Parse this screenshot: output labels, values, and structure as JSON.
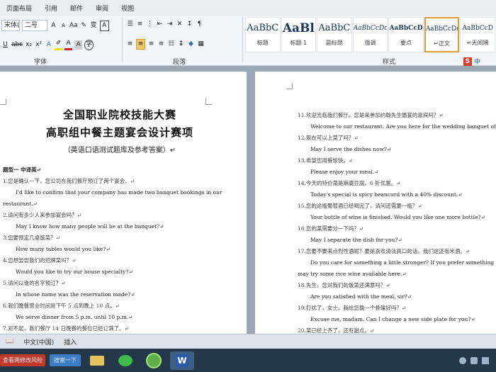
{
  "tabs": [
    "页面布局",
    "引用",
    "邮件",
    "审阅",
    "视图"
  ],
  "font": {
    "name": "宋体(正",
    "size": "二号"
  },
  "groups": {
    "font": "字体",
    "paragraph": "段落",
    "styles": "样式"
  },
  "styles": [
    {
      "preview": "AaBbC",
      "name": "标题"
    },
    {
      "preview": "AaBl",
      "name": "标题 1"
    },
    {
      "preview": "AaBbC",
      "name": "副标题"
    },
    {
      "preview": "AaBbCcDc",
      "name": "强调"
    },
    {
      "preview": "AaBbCcD",
      "name": "要点"
    },
    {
      "preview": "AaBbCcDc",
      "name": "↵正文"
    },
    {
      "preview": "AaBbCcD",
      "name": "↵无间隔"
    }
  ],
  "page1": {
    "title1": "全国职业院校技能大赛",
    "title2": "高职组中餐主题宴会设计赛项",
    "subtitle": "（英语口语测试题库及参考答案）↵",
    "section": "题型一 中译英↵",
    "lines": [
      {
        "t": "q",
        "text": "1.您是确认一下，您公司在我们餐厅预订了两个宴会。↵"
      },
      {
        "t": "a",
        "text": "I'd like to confirm that your company has made two banquet bookings in our"
      },
      {
        "t": "a",
        "text": "restaurant.↵"
      },
      {
        "t": "q",
        "text": "2.请问有多少人来参加宴会吗？↵"
      },
      {
        "t": "a",
        "text": "May I know how many people will be at the banquet?↵"
      },
      {
        "t": "q",
        "text": "3.您要预定几桌饭菜？↵"
      },
      {
        "t": "a",
        "text": "How many tables would you like?↵"
      },
      {
        "t": "q",
        "text": "4.您想尝尝我们的招牌菜吗？↵"
      },
      {
        "t": "a",
        "text": "Would you like to try our house specialty?↵"
      },
      {
        "t": "q",
        "text": "5.请问以谁的名字预订？↵"
      },
      {
        "t": "a",
        "text": "In whose name was the reservation made?↵"
      },
      {
        "t": "q",
        "text": "6.我们晚餐营业时间是下午 5 点到晚上 10 点。↵"
      },
      {
        "t": "a",
        "text": "We serve dinner from 5 p.m. until 10 p.m.↵"
      },
      {
        "t": "q",
        "text": "7.对不起，我们餐厅 14 日晚餐的餐位已经订满了。↵"
      }
    ]
  },
  "page2": {
    "lines": [
      {
        "t": "q",
        "text": "11.欢迎光临我们餐厅。您是来参加约翰先生婚宴的嘉宾吗？↵"
      },
      {
        "t": "a",
        "text": "Welcome to our restaurant. Are you here for the wedding banquet of Mr John?↵"
      },
      {
        "t": "q",
        "text": "12.现在可以上菜了吗？↵"
      },
      {
        "t": "a",
        "text": "May I serve the dishes now?↵"
      },
      {
        "t": "q",
        "text": "13.希望您用餐愉快。↵"
      },
      {
        "t": "a",
        "text": "Please enjoy your meal.↵"
      },
      {
        "t": "q",
        "text": "14.今天的特价菜是麻婆豆腐，6 折优惠。↵"
      },
      {
        "t": "a",
        "text": "Today's special is spicy beancurd with a 40% discount.↵"
      },
      {
        "t": "q",
        "text": "15.您的这瓶葡萄酒已经喝完了，请问还需要一瓶？↵"
      },
      {
        "t": "a",
        "text": "Your bottle of wine is finished. Would you like one more bottle?↵"
      },
      {
        "t": "q",
        "text": "16.您的菜需要分一下吗？↵"
      },
      {
        "t": "a",
        "text": "May I separate the dish for you?↵"
      },
      {
        "t": "q",
        "text": "17.您要不要来点烈性酒呢？要是喜欢清淡爽口的话，我们这还有米酒。↵"
      },
      {
        "t": "a",
        "text": "Do you care for something a little stronger? If you prefer something milder, you"
      },
      {
        "t": "a",
        "text": "may try some rice wine available here.↵"
      },
      {
        "t": "q",
        "text": "18.先生，您对我们的饭菜还满意吗？↵"
      },
      {
        "t": "a",
        "text": "Are you satisfied with the meal, sir?↵"
      },
      {
        "t": "q",
        "text": "19.打扰了，女士。我给您换一个骨碟好吗？↵"
      },
      {
        "t": "a",
        "text": "Excuse me, madam. Can I change a new side plate for you?↵"
      },
      {
        "t": "q",
        "text": "20.菜已经上齐了，还有甜点。↵"
      }
    ]
  },
  "status": {
    "language": "中文(中国)",
    "mode": "插入"
  },
  "taskbar": {
    "item1": "查看两修改风险",
    "item2": "搜索一下"
  },
  "ime": {
    "label": "中"
  }
}
